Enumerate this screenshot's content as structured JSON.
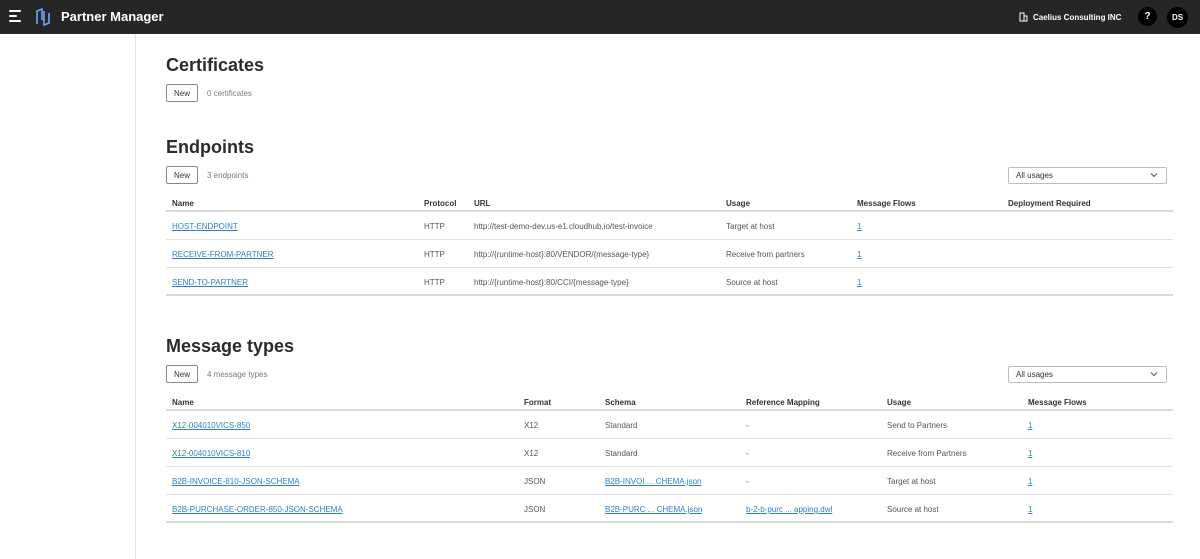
{
  "header": {
    "app_title": "Partner Manager",
    "org_name": "Caelius Consulting INC",
    "help_label": "?",
    "user_initials": "DS"
  },
  "icons": {
    "menu": "hamburger-menu-icon",
    "logo": "partner-manager-logo-icon",
    "org": "building-icon",
    "dropdown": "chevron-down-icon"
  },
  "colors": {
    "topbar": "#262626",
    "link": "#2f7fc8",
    "avatar": "#000000"
  },
  "certificates": {
    "title": "Certificates",
    "new_label": "New",
    "count": "0 certificates"
  },
  "endpoints": {
    "title": "Endpoints",
    "new_label": "New",
    "count": "3 endpoints",
    "filter": "All usages",
    "columns": [
      "Name",
      "Protocol",
      "URL",
      "Usage",
      "Message Flows",
      "Deployment Required"
    ],
    "rows": [
      {
        "name": "HOST-ENDPOINT",
        "protocol": "HTTP",
        "url": "http://test-demo-dev.us-e1.cloudhub.io/test-invoice",
        "usage": "Target at host",
        "flows": "1",
        "deployment": ""
      },
      {
        "name": "RECEIVE-FROM-PARTNER",
        "protocol": "HTTP",
        "url": "http://{runtime-host}:80/VENDOR/{message-type}",
        "usage": "Receive from partners",
        "flows": "1",
        "deployment": ""
      },
      {
        "name": "SEND-TO-PARTNER",
        "protocol": "HTTP",
        "url": "http://{runtime-host}:80/CCI/{message-type}",
        "usage": "Source at host",
        "flows": "1",
        "deployment": ""
      }
    ]
  },
  "message_types": {
    "title": "Message types",
    "new_label": "New",
    "count": "4 message types",
    "filter": "All usages",
    "columns": [
      "Name",
      "Format",
      "Schema",
      "Reference Mapping",
      "Usage",
      "Message Flows"
    ],
    "rows": [
      {
        "name": "X12-004010VICS-850",
        "format": "X12",
        "schema": "Standard",
        "mapping": "-",
        "usage": "Send to Partners",
        "flows": "1"
      },
      {
        "name": "X12-004010VICS-810",
        "format": "X12",
        "schema": "Standard",
        "mapping": "-",
        "usage": "Receive from Partners",
        "flows": "1"
      },
      {
        "name": "B2B-INVOICE-810-JSON-SCHEMA",
        "format": "JSON",
        "schema": "B2B-INVOI ... CHEMA.json",
        "mapping": "-",
        "usage": "Target at host",
        "flows": "1"
      },
      {
        "name": "B2B-PURCHASE-ORDER-850-JSON-SCHEMA",
        "format": "JSON",
        "schema": "B2B-PURC ... CHEMA.json",
        "mapping": "b-2-b-purc ... apping.dwl",
        "usage": "Source at host",
        "flows": "1"
      }
    ]
  }
}
